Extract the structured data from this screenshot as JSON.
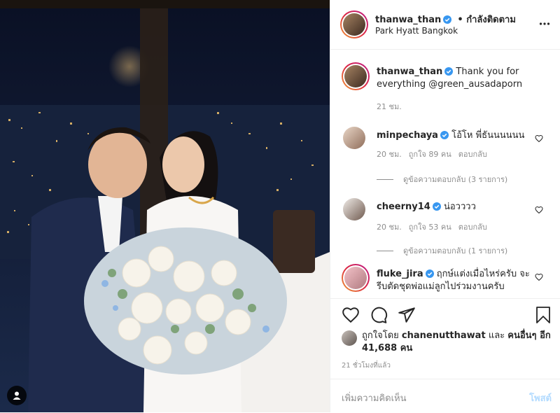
{
  "post": {
    "author": "thanwa_than",
    "follow_status": "• กำลังติดตาม",
    "location": "Park Hyatt Bangkok",
    "caption": "Thank you for everything @green_ausadaporn",
    "caption_time": "21 ชม.",
    "more_icon": "more-dots-icon"
  },
  "comments": [
    {
      "user": "minpechaya",
      "text": "โอ้โห พี่ธันนนนนน",
      "time": "20 ชม.",
      "likes": "ถูกใจ 89 คน",
      "reply": "ตอบกลับ",
      "view_replies": "ดูข้อความตอบกลับ (3 รายการ)"
    },
    {
      "user": "cheerny14",
      "text": "น่อวววว",
      "time": "20 ชม.",
      "likes": "ถูกใจ 53 คน",
      "reply": "ตอบกลับ",
      "view_replies": "ดูข้อความตอบกลับ (1 รายการ)"
    },
    {
      "user": "fluke_jira",
      "text": "ฤกษ์แต่งเมื่อไหร่ครับ จะรีบตัดชุดพ่อแม่ลูกไปร่วมงานครับ"
    }
  ],
  "likes": {
    "liked_by_prefix": "ถูกใจโดย",
    "liked_by_user": "chanenutthawat",
    "and": "และ",
    "others": "คนอื่นๆ อีก 41,688 คน"
  },
  "timestamp": "21 ชั่วโมงที่แล้ว",
  "add_comment": {
    "placeholder": "เพิ่มความคิดเห็น",
    "post_label": "โพสต์"
  },
  "colors": {
    "verified": "#3897f0",
    "link": "#00376b",
    "muted": "#8e8e8e",
    "post_disabled": "#b3dbff"
  }
}
